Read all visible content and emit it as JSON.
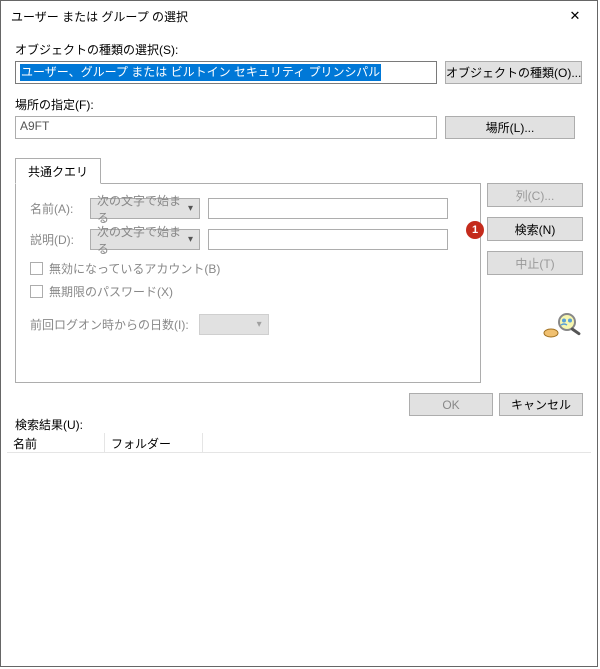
{
  "title": "ユーザー または グループ の選択",
  "object_type_section": {
    "label": "オブジェクトの種類の選択(S):",
    "value": "ユーザー、グループ または ビルトイン セキュリティ プリンシパル",
    "button": "オブジェクトの種類(O)..."
  },
  "location_section": {
    "label": "場所の指定(F):",
    "value": "A9FT",
    "button": "場所(L)..."
  },
  "tab": {
    "label": "共通クエリ",
    "name": {
      "label": "名前(A):",
      "mode": "次の文字で始まる"
    },
    "desc": {
      "label": "説明(D):",
      "mode": "次の文字で始まる"
    },
    "check_disabled": "無効になっているアカウント(B)",
    "check_noexpire": "無期限のパスワード(X)",
    "days_label": "前回ログオン時からの日数(I):"
  },
  "right_buttons": {
    "columns": "列(C)...",
    "find": "検索(N)",
    "stop": "中止(T)",
    "badge": "1"
  },
  "footer": {
    "ok": "OK",
    "cancel": "キャンセル"
  },
  "results": {
    "label": "検索結果(U):",
    "col_name": "名前",
    "col_folder": "フォルダー"
  }
}
